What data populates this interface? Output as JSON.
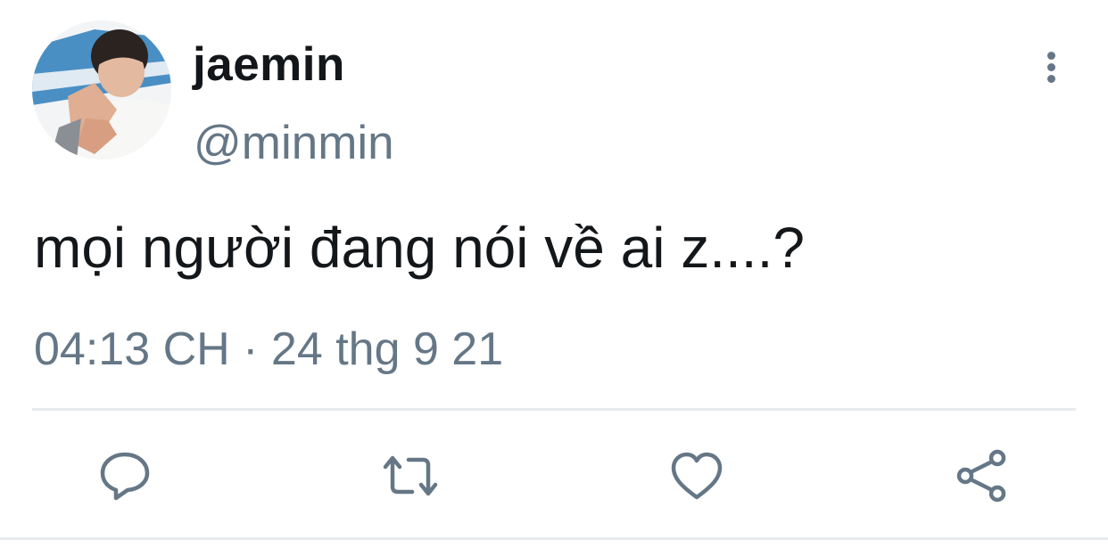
{
  "user": {
    "display_name": "jaemin",
    "handle": "@minmin",
    "avatar_icon": "user-avatar"
  },
  "tweet": {
    "text": "mọi người đang nói về ai z....?",
    "time": "04:13 CH",
    "separator": "·",
    "date": "24 thg 9 21"
  },
  "actions": [
    {
      "name": "reply",
      "icon": "comment-icon"
    },
    {
      "name": "retweet",
      "icon": "retweet-icon"
    },
    {
      "name": "like",
      "icon": "heart-icon"
    },
    {
      "name": "share",
      "icon": "share-icon"
    }
  ],
  "menu": {
    "icon": "more-vertical-icon"
  },
  "colors": {
    "text": "#14171a",
    "secondary": "#657786",
    "divider": "#e6ecf0"
  }
}
